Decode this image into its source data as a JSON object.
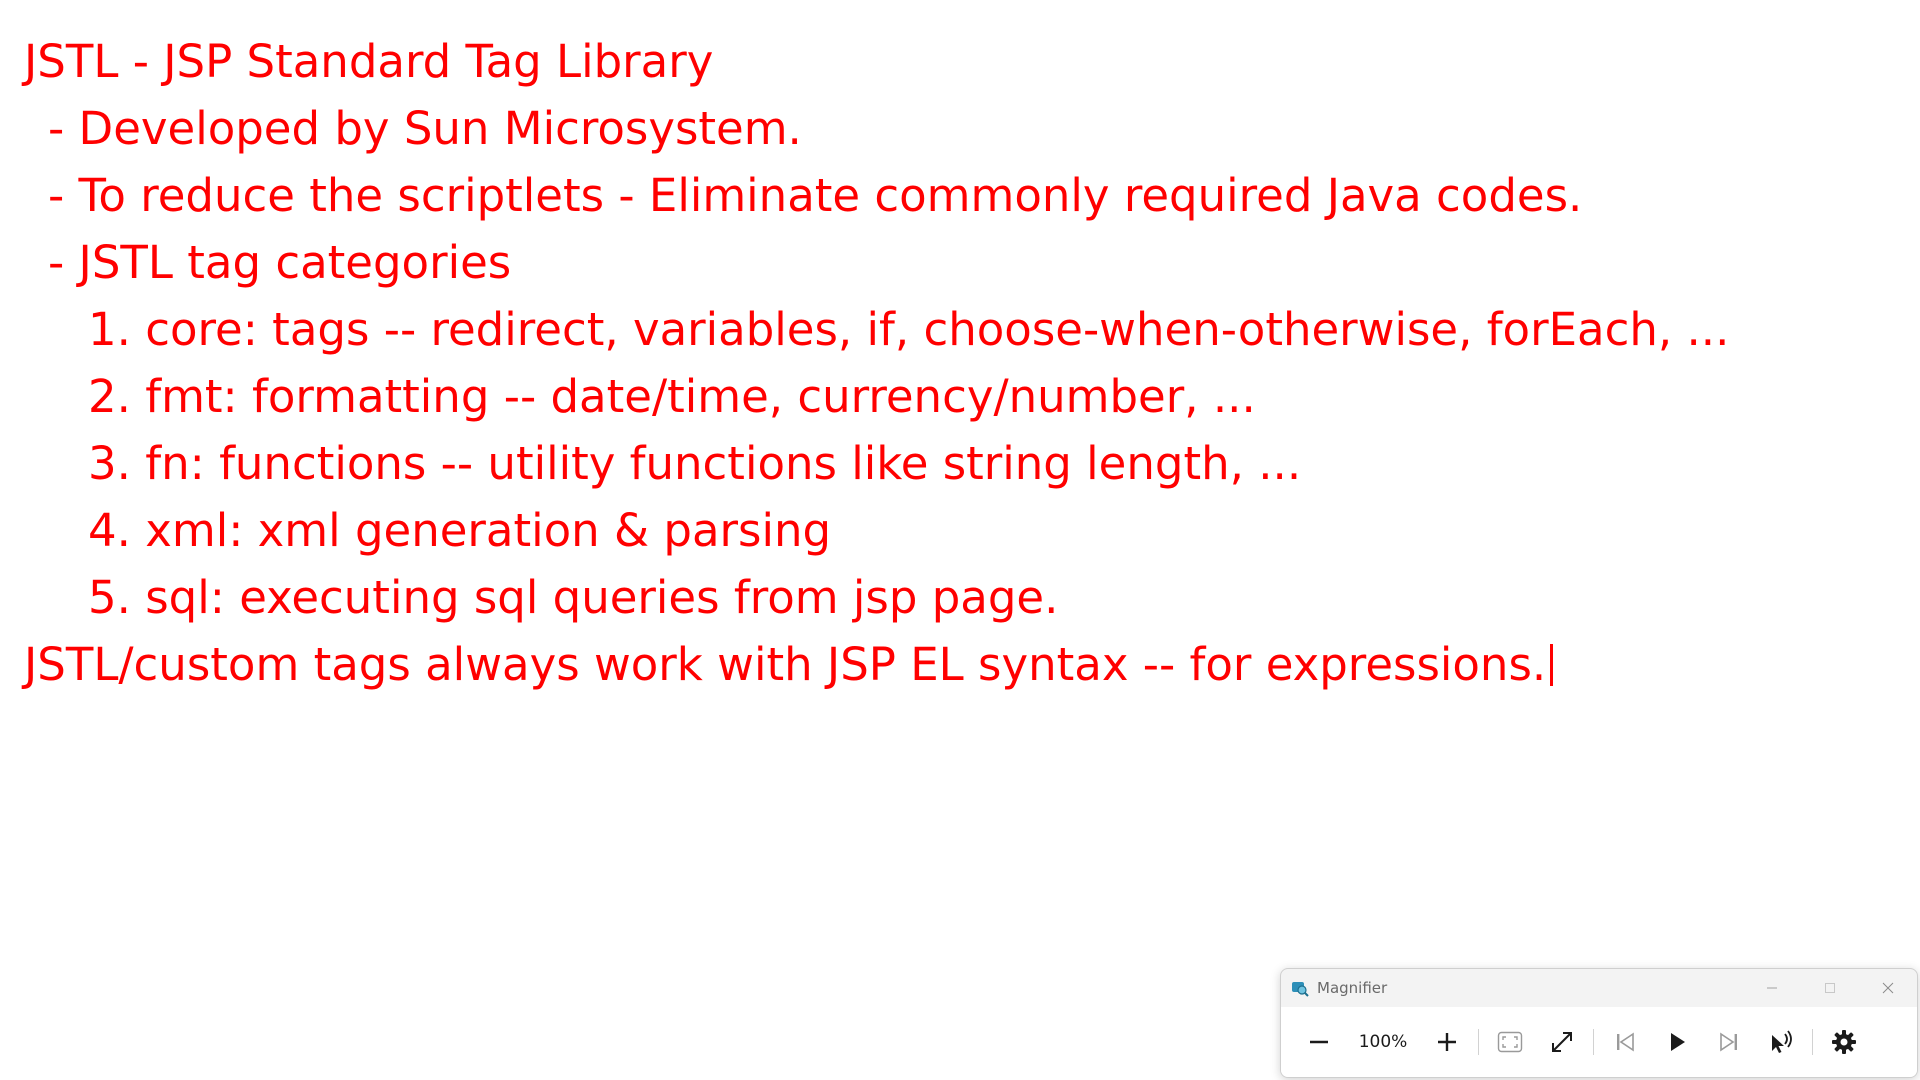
{
  "notes": {
    "lines": [
      "JSTL - JSP Standard Tag Library",
      "- Developed by Sun Microsystem.",
      "- To reduce the scriptlets - Eliminate commonly required Java codes.",
      "- JSTL tag categories",
      "1. core: tags -- redirect, variables, if, choose-when-otherwise, forEach, ...",
      "2. fmt: formatting -- date/time, currency/number, ...",
      "3. fn: functions -- utility functions like string length, ...",
      "4. xml: xml generation & parsing",
      "5. sql: executing sql queries from jsp page.",
      "JSTL/custom tags always work with JSP EL syntax -- for expressions."
    ]
  },
  "magnifier": {
    "title": "Magnifier",
    "zoom_level": "100%",
    "icons": {
      "app": "magnifier-app-icon",
      "minimize": "minimize-icon",
      "maximize": "maximize-icon",
      "close": "close-icon",
      "zoom_out": "minus-icon",
      "zoom_in": "plus-icon",
      "fullscreen": "fullscreen-icon",
      "resize": "resize-arrow-icon",
      "previous": "skip-previous-icon",
      "play": "play-icon",
      "next": "skip-next-icon",
      "read_from_cursor": "read-from-pointer-icon",
      "settings": "gear-icon"
    },
    "colors": {
      "text": "#ff0000",
      "window_bg": "#f3f3f3",
      "toolbar_bg": "#ffffff"
    }
  }
}
